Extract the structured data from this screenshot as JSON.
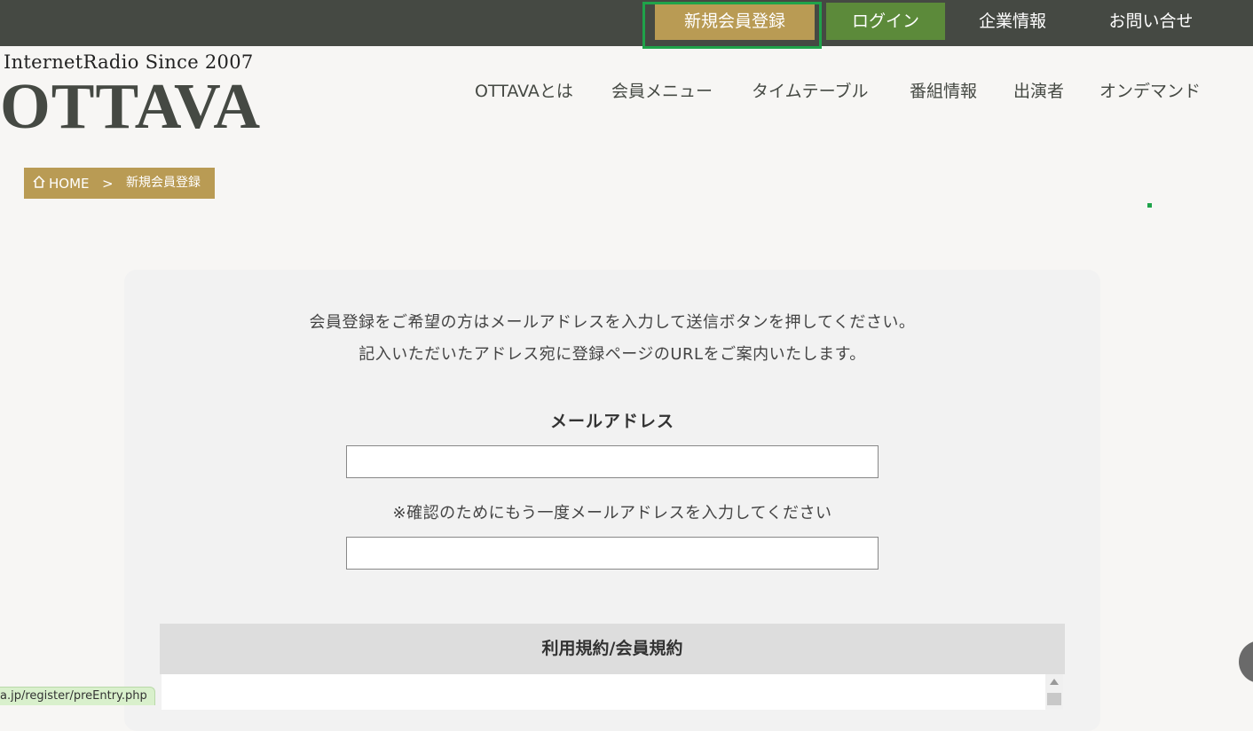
{
  "topbar": {
    "register_label": "新規会員登録",
    "login_label": "ログイン",
    "company_label": "企業情報",
    "contact_label": "お問い合せ"
  },
  "logo": {
    "subtitle": "InternetRadio Since 2007",
    "name": "OTTAVA"
  },
  "nav": {
    "items": [
      "OTTAVAとは",
      "会員メニュー",
      "タイムテーブル",
      "番組情報",
      "出演者",
      "オンデマンド"
    ]
  },
  "breadcrumb": {
    "home": "HOME",
    "separator": ">",
    "current": "新規会員登録"
  },
  "form": {
    "intro_line1": "会員登録をご希望の方はメールアドレスを入力して送信ボタンを押してください。",
    "intro_line2": "記入いただいたアドレス宛に登録ページのURLをご案内いたします。",
    "email_label": "メールアドレス",
    "email_value": "",
    "confirm_label": "※確認のためにもう一度メールアドレスを入力してください",
    "confirm_value": ""
  },
  "terms": {
    "title": "利用規約/会員規約"
  },
  "status_bar": {
    "url": "a.jp/register/preEntry.php"
  },
  "colors": {
    "topbar_bg": "#454943",
    "accent_gold": "#b99b54",
    "login_green": "#5c8a3a",
    "focus_green": "#1fa34a"
  }
}
